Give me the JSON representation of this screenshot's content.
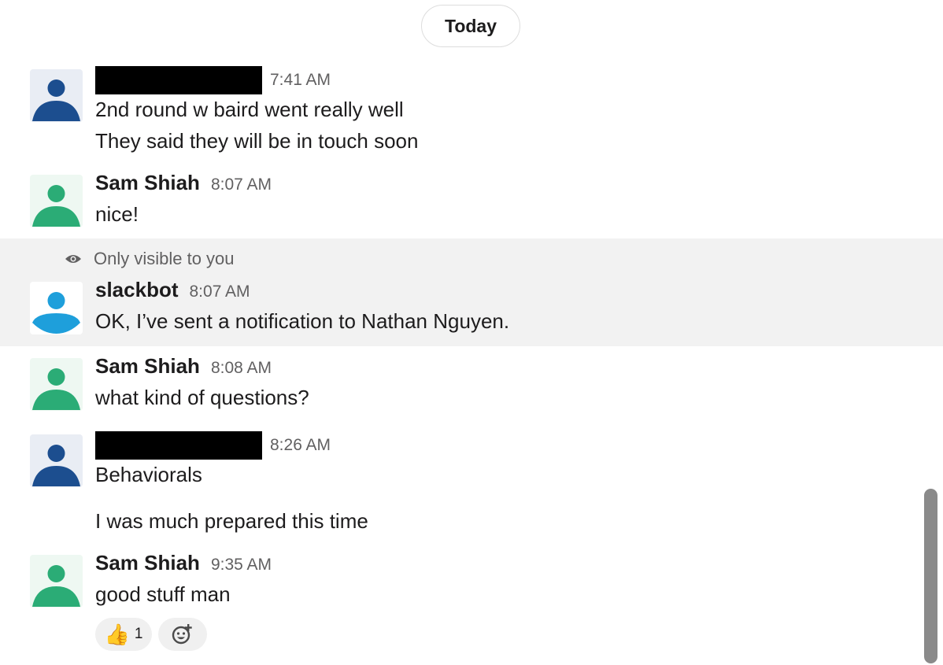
{
  "day_divider": {
    "label": "Today"
  },
  "visibility_note": {
    "icon": "eye-icon",
    "text": "Only visible to you"
  },
  "messages": [
    {
      "sender": "",
      "sender_redacted": true,
      "time": "7:41 AM",
      "avatar_color": "#1c4e8f",
      "avatar_bg": "#e9edf4",
      "lines": [
        "2nd round w baird went really well",
        "They said they will be in touch soon"
      ]
    },
    {
      "sender": "Sam Shiah",
      "time": "8:07 AM",
      "avatar_color": "#2bac76",
      "avatar_bg": "#eef8f2",
      "lines": [
        "nice!"
      ]
    },
    {
      "sender": "slackbot",
      "time": "8:07 AM",
      "avatar_color": "#1e9fdb",
      "avatar_bg": "#ffffff",
      "lines": [
        "OK, I’ve sent a notification to Nathan Nguyen."
      ]
    },
    {
      "sender": "Sam Shiah",
      "time": "8:08 AM",
      "avatar_color": "#2bac76",
      "avatar_bg": "#eef8f2",
      "lines": [
        "what kind of questions?"
      ]
    },
    {
      "sender": "",
      "sender_redacted": true,
      "time": "8:26 AM",
      "avatar_color": "#1c4e8f",
      "avatar_bg": "#e9edf4",
      "lines": [
        "Behaviorals",
        "I was much prepared this time"
      ]
    },
    {
      "sender": "Sam Shiah",
      "time": "9:35 AM",
      "avatar_color": "#2bac76",
      "avatar_bg": "#eef8f2",
      "lines": [
        "good stuff man"
      ]
    }
  ],
  "reactions": [
    {
      "emoji": "👍",
      "count": "1",
      "icon": "thumbs-up-icon"
    },
    {
      "icon": "add-reaction-icon"
    }
  ]
}
